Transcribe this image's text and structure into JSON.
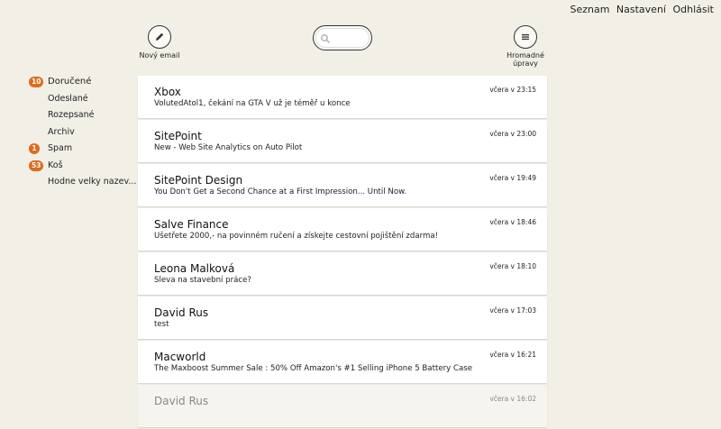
{
  "header": {
    "links": [
      "Seznam",
      "Nastavení",
      "Odhlásit"
    ]
  },
  "toolbar": {
    "compose_label": "Nový email",
    "bulk_label": "Hromadné úpravy",
    "search_placeholder": ""
  },
  "sidebar": {
    "items": [
      {
        "label": "Doručené",
        "badge": "10"
      },
      {
        "label": "Odeslané",
        "badge": ""
      },
      {
        "label": "Rozepsané",
        "badge": ""
      },
      {
        "label": "Archiv",
        "badge": ""
      },
      {
        "label": "Spam",
        "badge": "1"
      },
      {
        "label": "Koš",
        "badge": "53"
      },
      {
        "label": "Hodne velky nazev...",
        "badge": ""
      }
    ]
  },
  "emails": [
    {
      "from": "Xbox",
      "subject": "VolutedAtol1, čekání na GTA V už je téměř u konce",
      "time": "včera v 23:15"
    },
    {
      "from": "SitePoint",
      "subject": "New - Web Site Analytics on Auto Pilot",
      "time": "včera v 23:00"
    },
    {
      "from": "SitePoint Design",
      "subject": "You Don't Get a Second Chance at a First Impression... Until Now.",
      "time": "včera v 19:49"
    },
    {
      "from": "Salve Finance",
      "subject": "Ušetřete 2000,- na povinném ručení a získejte cestovní pojištění zdarma!",
      "time": "včera v 18:46"
    },
    {
      "from": "Leona Malková",
      "subject": "Sleva na stavební práce?",
      "time": "včera v 18:10"
    },
    {
      "from": "David Rus",
      "subject": "test",
      "time": "včera v 17:03"
    },
    {
      "from": "Macworld",
      "subject": "The Maxboost Summer Sale : 50% Off Amazon's #1 Selling iPhone 5 Battery Case",
      "time": "včera v 16:21"
    },
    {
      "from": "David Rus",
      "subject": "",
      "time": "včera v 16:02"
    }
  ],
  "colors": {
    "background": "#f2efe7",
    "badge": "#e06a1d"
  },
  "icons": {
    "compose": "pencil-icon",
    "search": "search-icon",
    "bulk": "menu-icon"
  }
}
